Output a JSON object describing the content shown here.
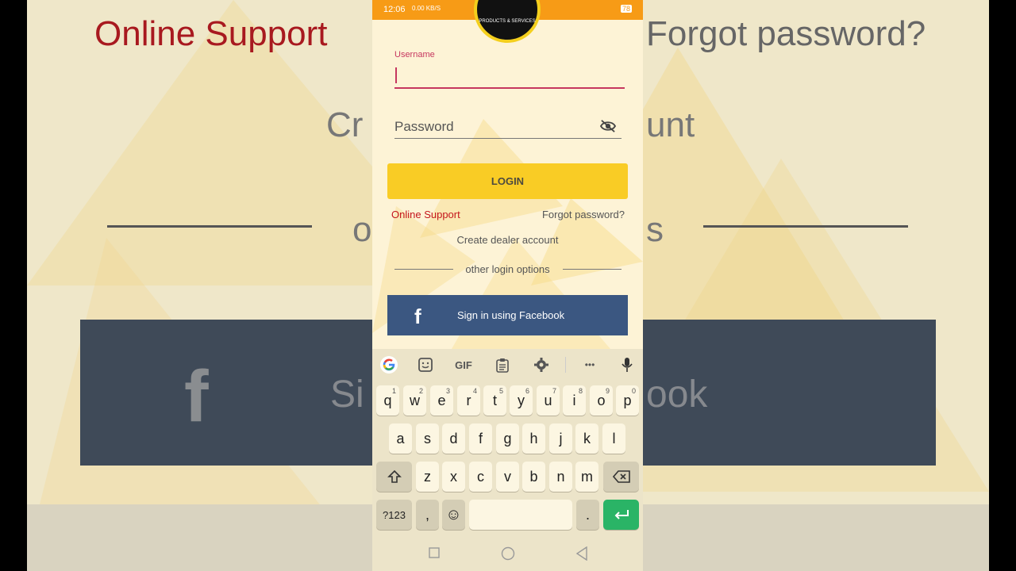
{
  "background": {
    "online_support": "Online Support",
    "forgot_password": "Forgot password?",
    "create_account_partial_left": "Cr",
    "create_account_partial_right": "unt",
    "other_partial_left": "o",
    "other_partial_right": "s",
    "facebook_partial_left": "Si",
    "facebook_partial_right": "ook",
    "facebook_f": "f"
  },
  "status_bar": {
    "time": "12:06",
    "network_text": "0.00 KB/S",
    "battery": "78"
  },
  "logo": {
    "text": "PRODUCTS & SERVICES"
  },
  "form": {
    "username_label": "Username",
    "username_value": "",
    "password_placeholder": "Password",
    "login_label": "LOGIN",
    "online_support_label": "Online Support",
    "forgot_password_label": "Forgot password?",
    "create_dealer_label": "Create dealer account",
    "other_options_label": "other login options",
    "facebook_label": "Sign in using Facebook",
    "facebook_icon": "f"
  },
  "keyboard": {
    "toolbar": {
      "gif_label": "GIF",
      "more_label": "•••"
    },
    "row1": [
      {
        "key": "q",
        "num": "1"
      },
      {
        "key": "w",
        "num": "2"
      },
      {
        "key": "e",
        "num": "3"
      },
      {
        "key": "r",
        "num": "4"
      },
      {
        "key": "t",
        "num": "5"
      },
      {
        "key": "y",
        "num": "6"
      },
      {
        "key": "u",
        "num": "7"
      },
      {
        "key": "i",
        "num": "8"
      },
      {
        "key": "o",
        "num": "9"
      },
      {
        "key": "p",
        "num": "0"
      }
    ],
    "row2": [
      "a",
      "s",
      "d",
      "f",
      "g",
      "h",
      "j",
      "k",
      "l"
    ],
    "row3": [
      "z",
      "x",
      "c",
      "v",
      "b",
      "n",
      "m"
    ],
    "symbols_label": "?123",
    "comma_label": ",",
    "period_label": ".",
    "emoji_label": "☺"
  },
  "colors": {
    "status_bar": "#f79b16",
    "accent": "#c6375f",
    "login_button": "#f9cc25",
    "facebook": "#3b5781",
    "online_support": "#c4161c",
    "enter_key": "#2ab466"
  }
}
